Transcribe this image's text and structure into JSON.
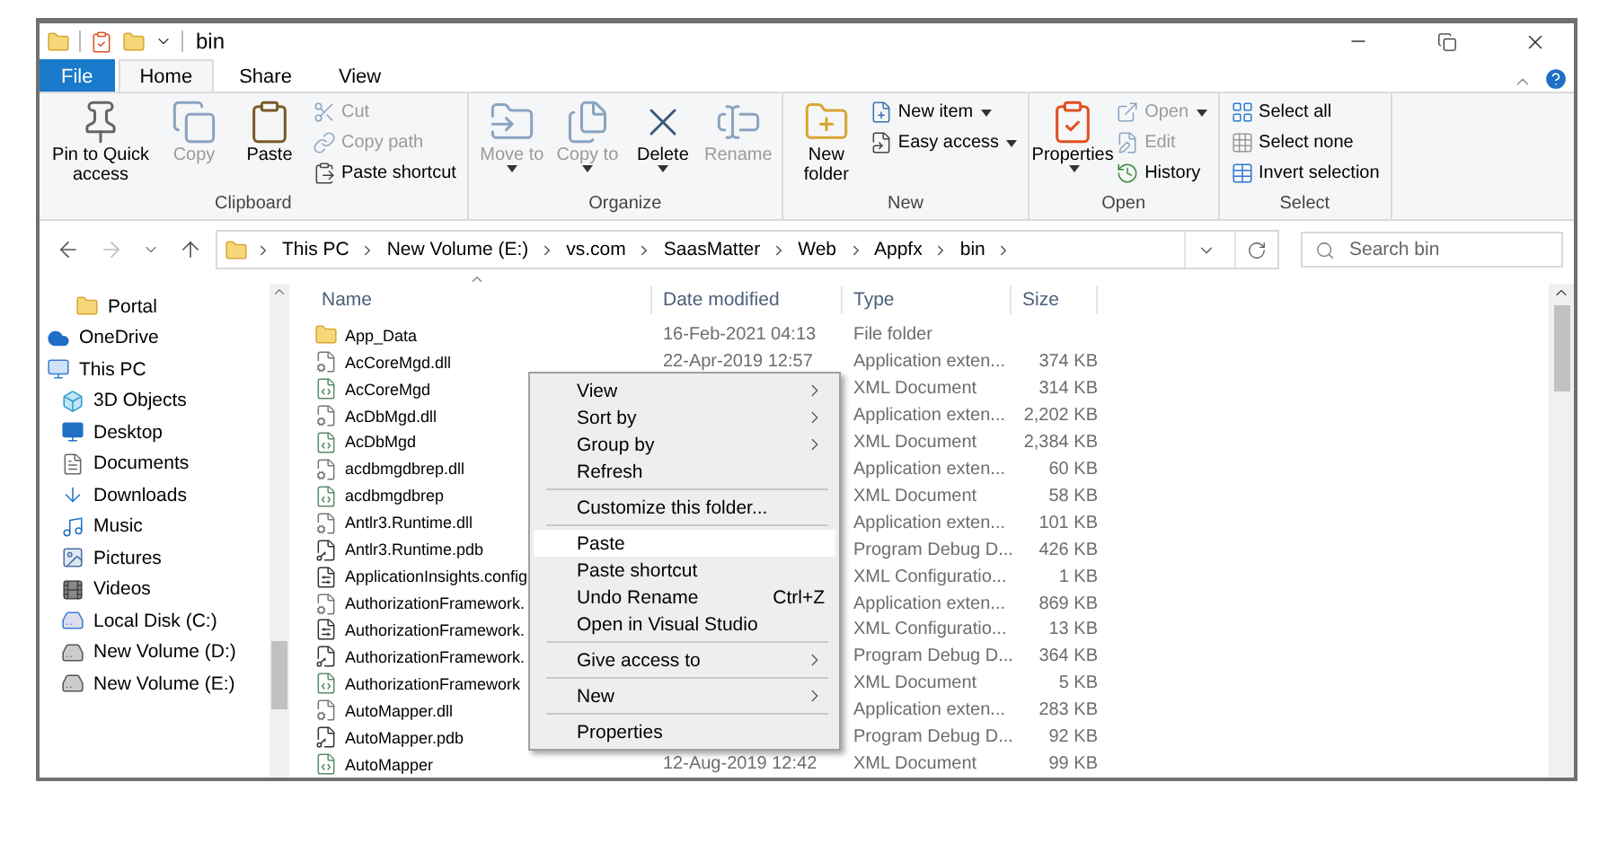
{
  "window": {
    "title": "bin"
  },
  "ribbon_tabs": [
    {
      "label": "File",
      "kind": "file",
      "selected": false
    },
    {
      "label": "Home",
      "kind": "tab",
      "selected": true
    },
    {
      "label": "Share",
      "kind": "tab",
      "selected": false
    },
    {
      "label": "View",
      "kind": "tab",
      "selected": false
    }
  ],
  "ribbon_groups": [
    {
      "name": "Clipboard",
      "large": [
        {
          "label": "Pin to Quick access",
          "disabled": false
        },
        {
          "label": "Copy",
          "disabled": true
        },
        {
          "label": "Paste",
          "disabled": false
        }
      ],
      "small": [
        {
          "label": "Cut",
          "disabled": true
        },
        {
          "label": "Copy path",
          "disabled": true
        },
        {
          "label": "Paste shortcut",
          "disabled": false
        }
      ]
    },
    {
      "name": "Organize",
      "large": [
        {
          "label": "Move to",
          "disabled": true,
          "dropdown": true
        },
        {
          "label": "Copy to",
          "disabled": true,
          "dropdown": true
        },
        {
          "label": "Delete",
          "disabled": false,
          "dropdown": true
        },
        {
          "label": "Rename",
          "disabled": true,
          "dropdown": false
        }
      ]
    },
    {
      "name": "New",
      "large": [
        {
          "label": "New folder",
          "disabled": false,
          "dropdown": false
        }
      ],
      "small": [
        {
          "label": "New item",
          "disabled": false,
          "dropdown": true
        },
        {
          "label": "Easy access",
          "disabled": false,
          "dropdown": true
        }
      ]
    },
    {
      "name": "Open",
      "large": [
        {
          "label": "Properties",
          "disabled": false,
          "dropdown": true
        }
      ],
      "small": [
        {
          "label": "Open",
          "disabled": true,
          "dropdown": true
        },
        {
          "label": "Edit",
          "disabled": true,
          "dropdown": false
        },
        {
          "label": "History",
          "disabled": false,
          "dropdown": false
        }
      ]
    },
    {
      "name": "Select",
      "small": [
        {
          "label": "Select all",
          "disabled": false
        },
        {
          "label": "Select none",
          "disabled": false
        },
        {
          "label": "Invert selection",
          "disabled": false
        }
      ]
    }
  ],
  "address": {
    "path": [
      "This PC",
      "New Volume (E:)",
      "vs.com",
      "SaasMatter",
      "Web",
      "Appfx",
      "bin"
    ]
  },
  "search": {
    "placeholder": "Search bin"
  },
  "sidebar": {
    "items": [
      {
        "label": "Portal",
        "kind": "folder"
      },
      {
        "label": "OneDrive",
        "kind": "cloud"
      },
      {
        "label": "This PC",
        "kind": "pc",
        "children": [
          {
            "label": "3D Objects",
            "kind": "cube"
          },
          {
            "label": "Desktop",
            "kind": "desktop"
          },
          {
            "label": "Documents",
            "kind": "documents"
          },
          {
            "label": "Downloads",
            "kind": "downloads"
          },
          {
            "label": "Music",
            "kind": "music"
          },
          {
            "label": "Pictures",
            "kind": "pictures"
          },
          {
            "label": "Videos",
            "kind": "videos"
          },
          {
            "label": "Local Disk (C:)",
            "kind": "system-drive"
          },
          {
            "label": "New Volume (D:)",
            "kind": "drive"
          },
          {
            "label": "New Volume (E:)",
            "kind": "drive"
          }
        ]
      }
    ]
  },
  "table": {
    "columns": [
      "Name",
      "Date modified",
      "Type",
      "Size"
    ],
    "rows": [
      {
        "kind": "folder",
        "name": "App_Data",
        "date": "16-Feb-2021 04:13",
        "type": "File folder"
      },
      {
        "kind": "dll",
        "name": "AcCoreMgd.dll",
        "date": "22-Apr-2019 12:57",
        "type": "Application exten...",
        "size": "374 KB"
      },
      {
        "kind": "xml",
        "name": "AcCoreMgd",
        "type": "XML Document",
        "size": "314 KB"
      },
      {
        "kind": "dll",
        "name": "AcDbMgd.dll",
        "type": "Application exten...",
        "size": "2,202 KB"
      },
      {
        "kind": "xml",
        "name": "AcDbMgd",
        "type": "XML Document",
        "size": "2,384 KB"
      },
      {
        "kind": "dll",
        "name": "acdbmgdbrep.dll",
        "type": "Application exten...",
        "size": "60 KB"
      },
      {
        "kind": "xml",
        "name": "acdbmgdbrep",
        "type": "XML Document",
        "size": "58 KB"
      },
      {
        "kind": "dll",
        "name": "Antlr3.Runtime.dll",
        "type": "Application exten...",
        "size": "101 KB"
      },
      {
        "kind": "pdb",
        "name": "Antlr3.Runtime.pdb",
        "type": "Program Debug D...",
        "size": "426 KB"
      },
      {
        "kind": "config",
        "name": "ApplicationInsights.config",
        "type": "XML Configuratio...",
        "size": "1 KB"
      },
      {
        "kind": "dll",
        "name": "AuthorizationFramework.",
        "type": "Application exten...",
        "size": "869 KB"
      },
      {
        "kind": "config",
        "name": "AuthorizationFramework.",
        "type": "XML Configuratio...",
        "size": "13 KB"
      },
      {
        "kind": "pdb",
        "name": "AuthorizationFramework.",
        "type": "Program Debug D...",
        "size": "364 KB"
      },
      {
        "kind": "xml",
        "name": "AuthorizationFramework",
        "type": "XML Document",
        "size": "5 KB"
      },
      {
        "kind": "dll",
        "name": "AutoMapper.dll",
        "type": "Application exten...",
        "size": "283 KB"
      },
      {
        "kind": "pdb",
        "name": "AutoMapper.pdb",
        "type": "Program Debug D...",
        "size": "92 KB"
      },
      {
        "kind": "xml",
        "name": "AutoMapper",
        "date": "12-Aug-2019 12:42",
        "type": "XML Document",
        "size": "99 KB"
      }
    ]
  },
  "context_menu": {
    "items": [
      {
        "kind": "item",
        "label": "View",
        "submenu": true,
        "highlighted": false
      },
      {
        "kind": "item",
        "label": "Sort by",
        "submenu": true,
        "highlighted": false
      },
      {
        "kind": "item",
        "label": "Group by",
        "submenu": true,
        "highlighted": false
      },
      {
        "kind": "item",
        "label": "Refresh",
        "submenu": false,
        "highlighted": false
      },
      {
        "kind": "separator"
      },
      {
        "kind": "item",
        "label": "Customize this folder...",
        "submenu": false,
        "highlighted": false
      },
      {
        "kind": "separator"
      },
      {
        "kind": "item",
        "label": "Paste",
        "submenu": false,
        "highlighted": true
      },
      {
        "kind": "item",
        "label": "Paste shortcut",
        "submenu": false,
        "highlighted": false
      },
      {
        "kind": "item",
        "label": "Undo Rename",
        "shortcut": "Ctrl+Z",
        "submenu": false,
        "highlighted": false
      },
      {
        "kind": "item",
        "label": "Open in Visual Studio",
        "submenu": false,
        "highlighted": false
      },
      {
        "kind": "separator"
      },
      {
        "kind": "item",
        "label": "Give access to",
        "submenu": true,
        "highlighted": false
      },
      {
        "kind": "separator"
      },
      {
        "kind": "item",
        "label": "New",
        "submenu": true,
        "highlighted": false
      },
      {
        "kind": "separator"
      },
      {
        "kind": "item",
        "label": "Properties",
        "submenu": false,
        "highlighted": false
      }
    ]
  }
}
